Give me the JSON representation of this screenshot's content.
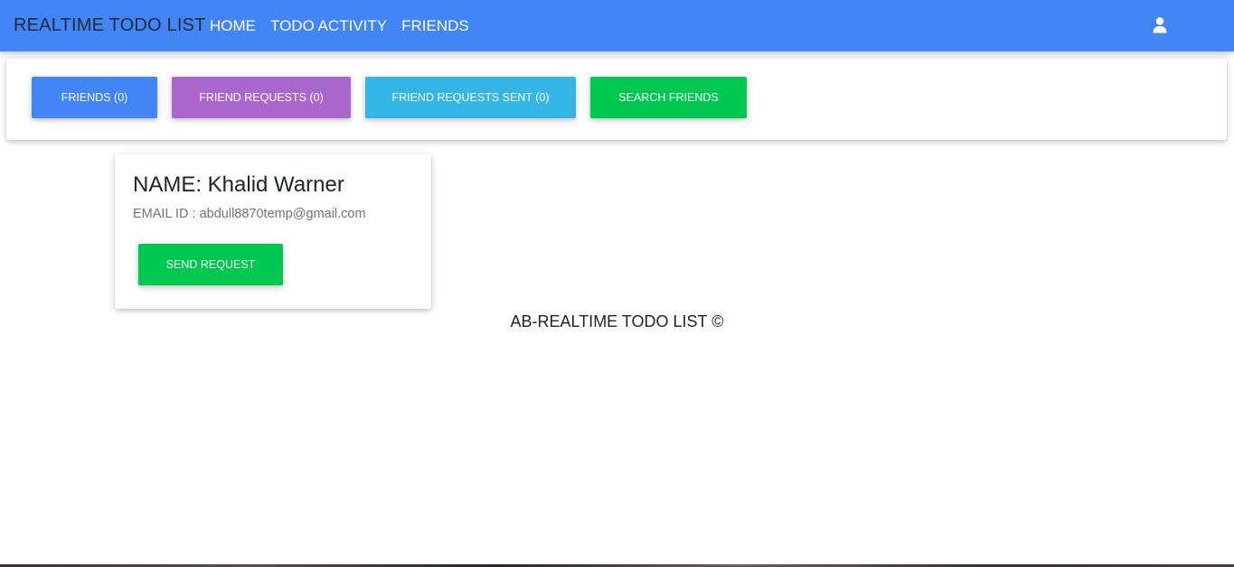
{
  "navbar": {
    "brand": "REALTIME TODO LIST",
    "links": [
      "HOME",
      "TODO ACTIVITY",
      "FRIENDS"
    ],
    "user_icon": "user-icon",
    "background_color": "#4285f4"
  },
  "tabs": {
    "friends": "FRIENDS (0)",
    "friend_requests": "FRIEND REQUESTS (0)",
    "friend_requests_sent": "FRIEND REQUESTS SENT (0)",
    "search_friends": "SEARCH FRIENDS"
  },
  "tab_colors": {
    "friends": "#4285f4",
    "friend_requests": "#aa66cc",
    "friend_requests_sent": "#33b5e5",
    "search_friends": "#00c851"
  },
  "result_card": {
    "name": "NAME: Khalid Warner",
    "email": "EMAIL ID : abdull8870temp@gmail.com",
    "send_label": "SEND REQUEST"
  },
  "footer": {
    "text": "AB-REALTIME TODO LIST ©"
  }
}
